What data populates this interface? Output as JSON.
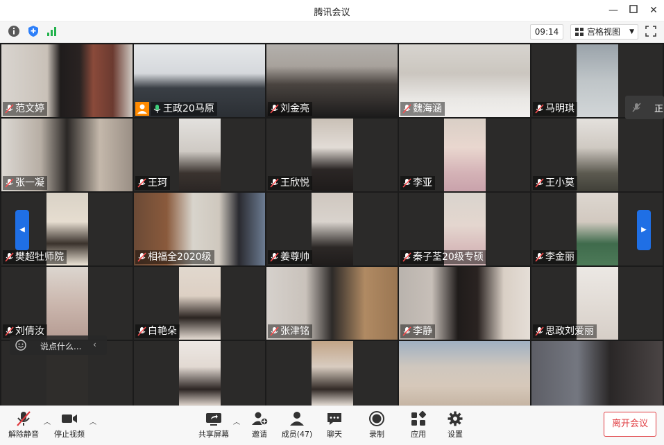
{
  "window": {
    "title": "腾讯会议"
  },
  "toolbar": {
    "timer": "09:14",
    "view_mode": "宫格视图"
  },
  "participants": [
    "范文婷",
    "王政20马原",
    "刘金亮",
    "魏海涵",
    "马明琪",
    "张一凝",
    "王珂",
    "王欣悦",
    "李亚",
    "王小莫",
    "樊超牡师院",
    "相福全2020级",
    "姜尊帅",
    "秦子荃20级专硕",
    "李金丽",
    "刘倩汝",
    "白艳朵",
    "张津铭",
    "李静",
    "思政刘爱丽"
  ],
  "partial_tile_text": "正",
  "chat": {
    "placeholder": "说点什么..."
  },
  "bottom_bar": {
    "unmute": "解除静音",
    "stop_video": "停止视频",
    "share_screen": "共享屏幕",
    "invite": "邀请",
    "members": "成员(47)",
    "chat": "聊天",
    "record": "录制",
    "apps": "应用",
    "settings": "设置",
    "leave": "离开会议"
  },
  "colors": {
    "active_speaker": "#3fd07d",
    "leave": "#e0393e",
    "host_badge": "#ff8a00",
    "nav_arrow": "#1f6fe5"
  }
}
